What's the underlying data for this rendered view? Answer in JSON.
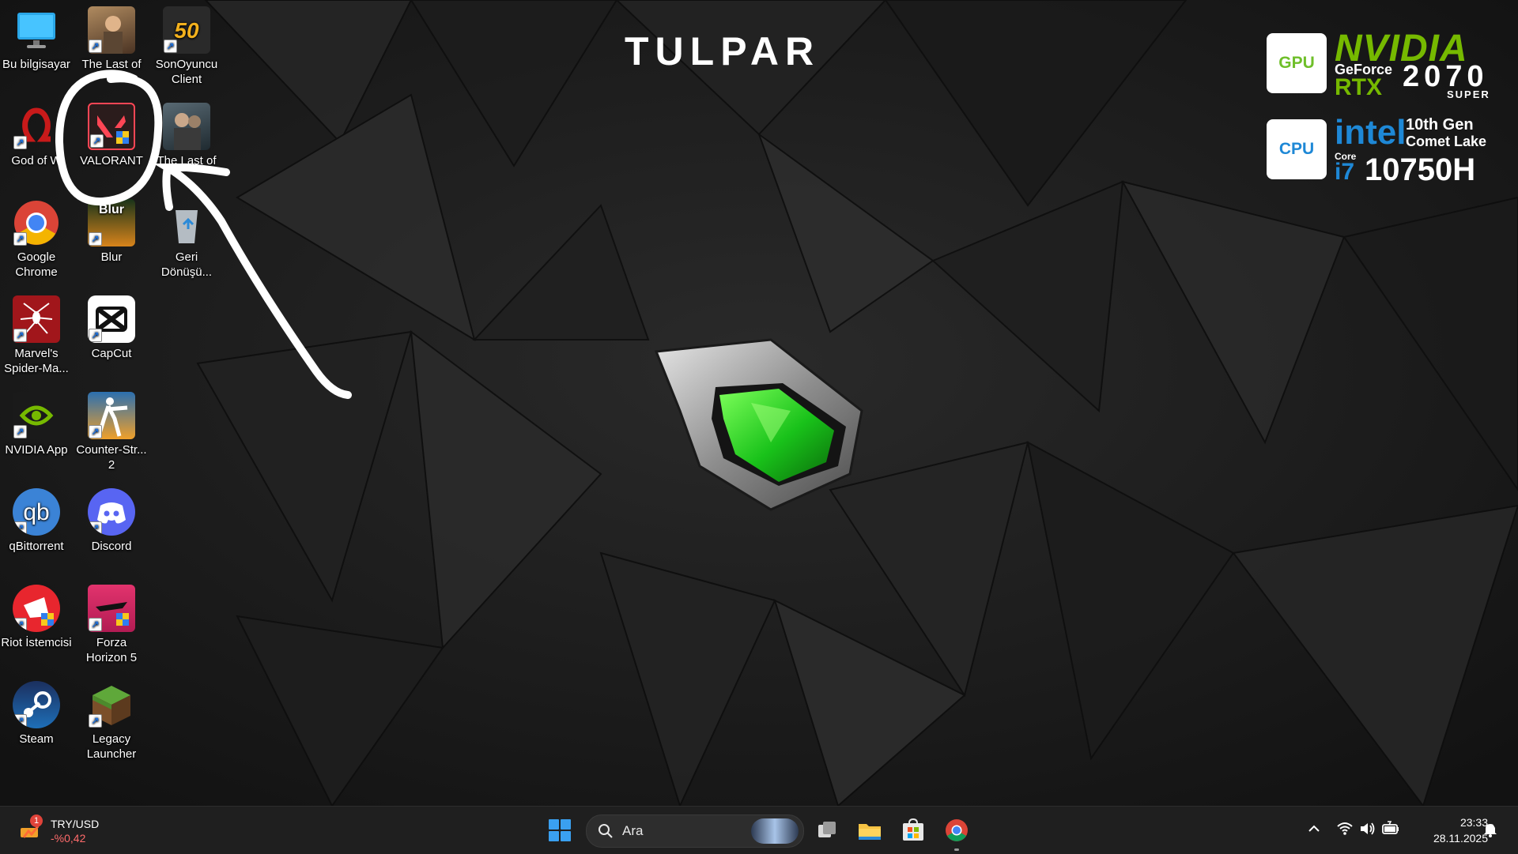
{
  "desktop": {
    "icons": [
      {
        "id": "this-pc",
        "label": "Bu bilgisayar",
        "shortcut": false
      },
      {
        "id": "last-of-us-1",
        "label": "The Last of",
        "shortcut": true
      },
      {
        "id": "sonoyuncu",
        "label": "SonOyuncu Client",
        "shortcut": true
      },
      {
        "id": "god-of-war",
        "label": "God of W",
        "shortcut": true
      },
      {
        "id": "valorant",
        "label": "VALORANT",
        "shortcut": true
      },
      {
        "id": "last-of-us-2",
        "label": "The Last of",
        "shortcut": true
      },
      {
        "id": "chrome",
        "label": "Google Chrome",
        "shortcut": true
      },
      {
        "id": "blur",
        "label": "Blur",
        "shortcut": true
      },
      {
        "id": "recycle-bin",
        "label": "Geri Dönüşü...",
        "shortcut": false
      },
      {
        "id": "spider-man",
        "label": "Marvel's Spider-Ma...",
        "shortcut": true
      },
      {
        "id": "capcut",
        "label": "CapCut",
        "shortcut": true
      },
      {
        "id": "nvidia-app",
        "label": "NVIDIA App",
        "shortcut": true
      },
      {
        "id": "counter-strike",
        "label": "Counter-Str... 2",
        "shortcut": true
      },
      {
        "id": "qbittorrent",
        "label": "qBittorrent",
        "shortcut": true
      },
      {
        "id": "discord",
        "label": "Discord",
        "shortcut": true
      },
      {
        "id": "riot-client",
        "label": "Riot İstemcisi",
        "shortcut": true
      },
      {
        "id": "forza",
        "label": "Forza Horizon 5",
        "shortcut": true
      },
      {
        "id": "steam",
        "label": "Steam",
        "shortcut": true
      },
      {
        "id": "legacy-launcher",
        "label": "Legacy Launcher",
        "shortcut": true
      }
    ],
    "icon_glyphs": {
      "sonoyuncu": "50",
      "qbittorrent": "qb",
      "blur": "Blur",
      "counter-strike": ""
    }
  },
  "wallpaper": {
    "brand": "TULPAR",
    "gpu": {
      "chip": "GPU",
      "brand": "NVIDIA",
      "line1": "GeForce",
      "line2": "RTX",
      "model": "2070",
      "suffix": "SUPER"
    },
    "cpu": {
      "chip": "CPU",
      "brand": "intel",
      "gen": "10th Gen",
      "codename": "Comet Lake",
      "core": "Core",
      "tier": "i7",
      "model": "10750H"
    },
    "accent": "#6fbf2a"
  },
  "taskbar": {
    "widget": {
      "badge": "1",
      "title": "TRY/USD",
      "value": "-%0,42",
      "value_color": "#ff6b6b"
    },
    "search_placeholder": "Ara",
    "clock": {
      "time": "23:33",
      "date": "28.11.2025"
    },
    "pinned": [
      "start",
      "search",
      "task-view",
      "file-explorer",
      "microsoft-store",
      "chrome"
    ]
  }
}
